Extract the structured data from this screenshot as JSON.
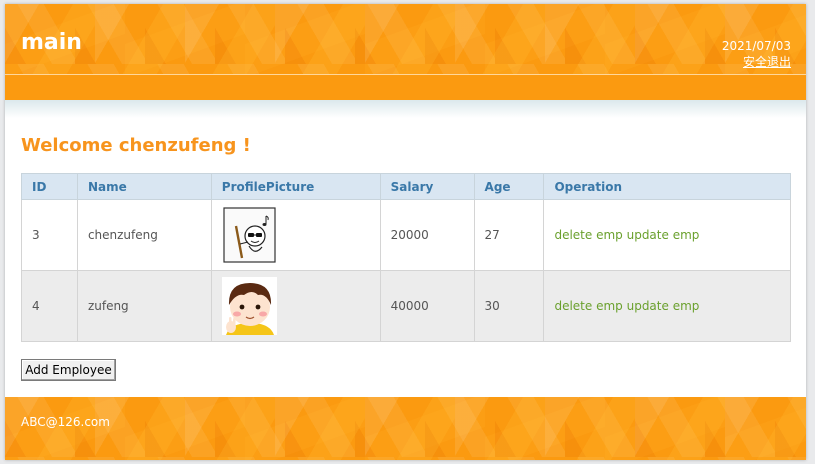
{
  "header": {
    "logo": "main",
    "date": "2021/07/03",
    "logout_label": "安全退出"
  },
  "welcome": "Welcome chenzufeng !",
  "table": {
    "columns": [
      "ID",
      "Name",
      "ProfilePicture",
      "Salary",
      "Age",
      "Operation"
    ],
    "rows": [
      {
        "id": "3",
        "name": "chenzufeng",
        "picture": "doodle-avatar",
        "salary": "20000",
        "age": "27",
        "delete_label": "delete emp",
        "update_label": "update emp"
      },
      {
        "id": "4",
        "name": "zufeng",
        "picture": "cartoon-boy-avatar",
        "salary": "40000",
        "age": "30",
        "delete_label": "delete emp",
        "update_label": "update emp"
      }
    ]
  },
  "add_button_label": "Add Employee",
  "footer": {
    "email": "ABC@126.com"
  },
  "colors": {
    "brand_orange": "#fb9a10",
    "welcome_text": "#f7941d",
    "header_row_bg": "#d9e6f2",
    "header_row_text": "#3a78a8",
    "link_green": "#6aa02d"
  }
}
